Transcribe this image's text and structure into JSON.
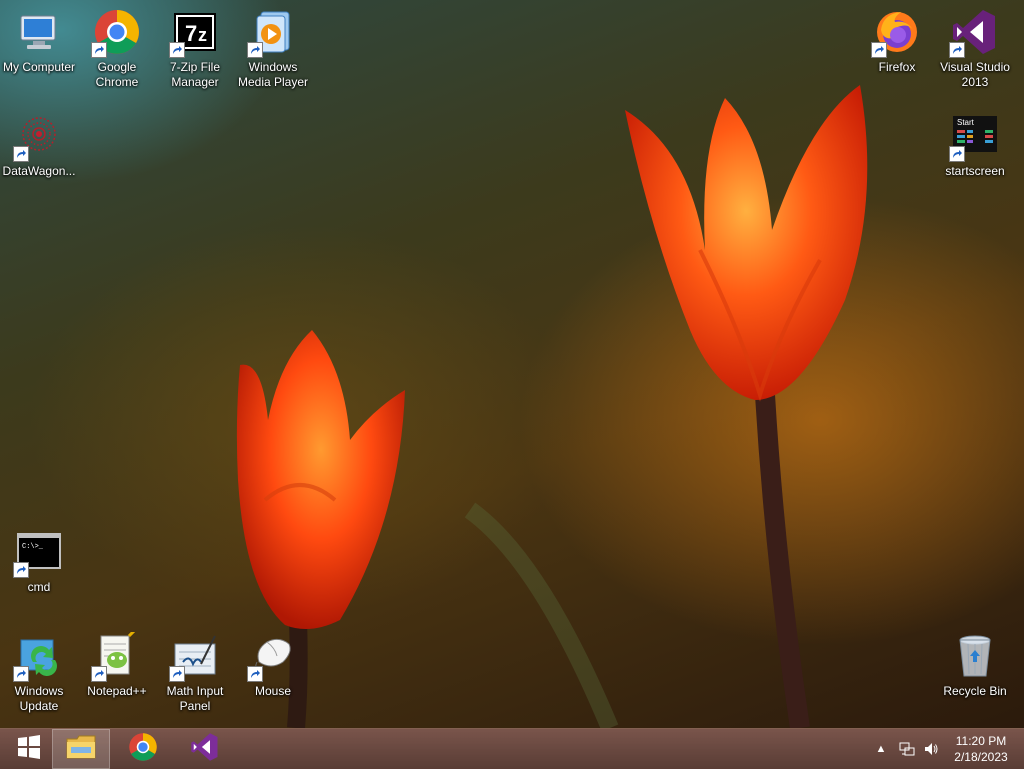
{
  "desktop": {
    "icons_left": [
      {
        "label": "My Computer",
        "icon": "computer-icon"
      },
      {
        "label": "Google\nChrome",
        "icon": "chrome-icon"
      },
      {
        "label": "7-Zip File\nManager",
        "icon": "7zip-icon"
      },
      {
        "label": "Windows\nMedia Player",
        "icon": "media-player-icon"
      },
      {
        "label": "DataWagon...",
        "icon": "datawagon-icon"
      },
      {
        "label": "cmd",
        "icon": "cmd-icon"
      },
      {
        "label": "Windows\nUpdate",
        "icon": "windows-update-icon"
      },
      {
        "label": "Notepad++",
        "icon": "notepadpp-icon"
      },
      {
        "label": "Math Input\nPanel",
        "icon": "math-input-icon"
      },
      {
        "label": "Mouse",
        "icon": "mouse-icon"
      }
    ],
    "icons_right": [
      {
        "label": "Firefox",
        "icon": "firefox-icon"
      },
      {
        "label": "Visual Studio\n2013",
        "icon": "visual-studio-icon"
      },
      {
        "label": "startscreen",
        "icon": "startscreen-icon",
        "thumb_text": "Start"
      },
      {
        "label": "Recycle Bin",
        "icon": "recycle-bin-icon"
      }
    ]
  },
  "taskbar": {
    "pinned": [
      {
        "name": "start-button",
        "icon": "windows-logo-icon"
      },
      {
        "name": "file-explorer",
        "icon": "folder-icon",
        "active": true
      },
      {
        "name": "chrome",
        "icon": "chrome-icon"
      },
      {
        "name": "visual-studio",
        "icon": "visual-studio-icon"
      }
    ],
    "tray": {
      "show_hidden": "▲",
      "network": "network-icon",
      "volume": "speaker-icon"
    },
    "clock": {
      "time": "11:20 PM",
      "date": "2/18/2023"
    }
  },
  "colors": {
    "taskbar": "#5a3a30",
    "tulip": "#ff4a12",
    "vs_purple": "#68217a"
  }
}
